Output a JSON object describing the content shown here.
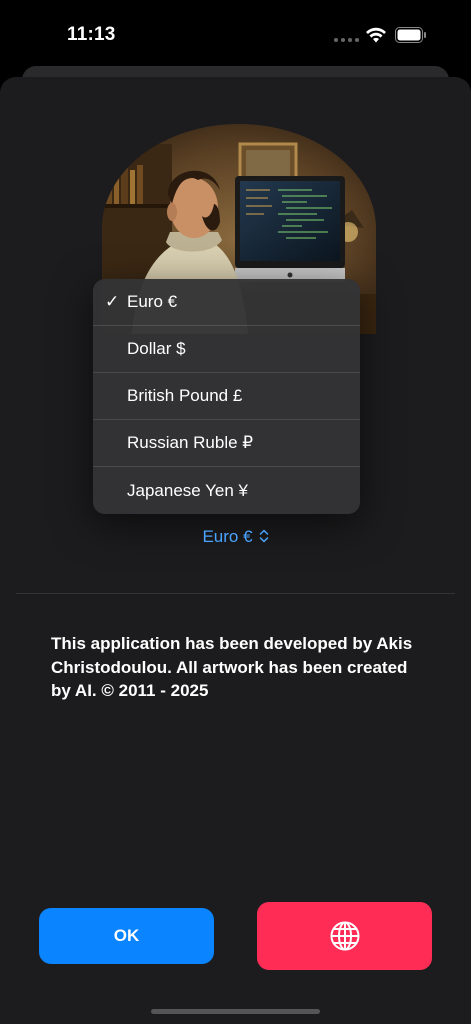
{
  "status": {
    "time": "11:13"
  },
  "currency_menu": {
    "items": [
      {
        "label": "Euro €",
        "checked": true
      },
      {
        "label": "Dollar $",
        "checked": false
      },
      {
        "label": "British Pound £",
        "checked": false
      },
      {
        "label": "Russian Ruble ₽",
        "checked": false
      },
      {
        "label": "Japanese Yen ¥",
        "checked": false
      }
    ],
    "check_mark": "✓"
  },
  "selector": {
    "value": "Euro €",
    "chevron": "⌃⌄"
  },
  "about": {
    "text": "This application has been developed by Akis Christodoulou. All artwork has been created by AI. © 2011 - 2025"
  },
  "buttons": {
    "ok_label": "OK",
    "web_icon": "globe-icon"
  },
  "colors": {
    "accent_blue": "#0a84ff",
    "link_blue": "#4aa3ff",
    "accent_red": "#ff2d55",
    "sheet_bg": "#1c1c1e"
  }
}
